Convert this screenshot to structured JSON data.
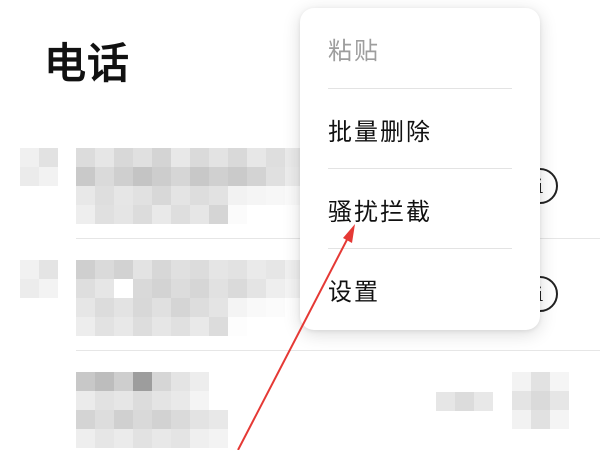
{
  "header": {
    "title": "电话"
  },
  "menu": {
    "items": [
      {
        "label": "粘贴",
        "enabled": false
      },
      {
        "label": "批量删除",
        "enabled": true
      },
      {
        "label": "骚扰拦截",
        "enabled": true
      },
      {
        "label": "设置",
        "enabled": true
      }
    ]
  },
  "call_log": {
    "rows": [
      {
        "contact": "[redacted]",
        "detail": "[redacted]",
        "action_icon": "info-icon"
      },
      {
        "contact": "[redacted]",
        "detail": "[redacted]",
        "action_icon": "info-icon"
      },
      {
        "contact": "[redacted]",
        "detail": "[redacted]",
        "action_icon": ""
      }
    ]
  },
  "annotation": {
    "type": "arrow",
    "color": "#e53935",
    "points_to": "骚扰拦截"
  }
}
